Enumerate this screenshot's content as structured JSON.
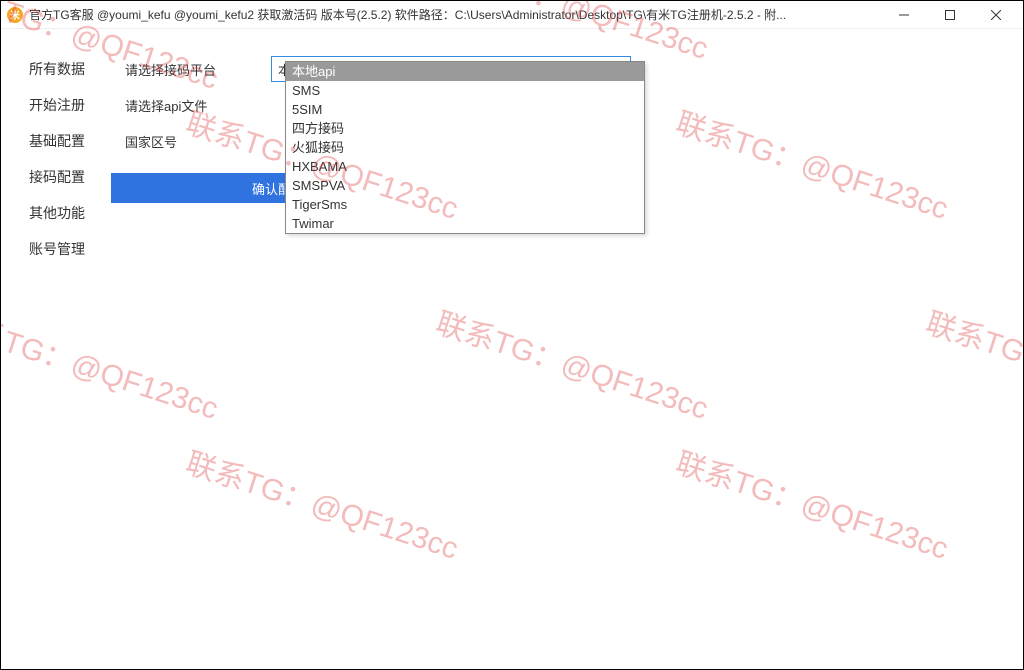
{
  "window": {
    "title": "官方TG客服 @youmi_kefu @youmi_kefu2 获取激活码 版本号(2.5.2) 软件路径：C:\\Users\\Administrator\\Desktop\\TG\\有米TG注册机-2.5.2  - 附...",
    "icon_glyph": "米"
  },
  "sidebar": {
    "items": [
      {
        "label": "所有数据"
      },
      {
        "label": "开始注册"
      },
      {
        "label": "基础配置"
      },
      {
        "label": "接码配置"
      },
      {
        "label": "其他功能"
      },
      {
        "label": "账号管理"
      }
    ]
  },
  "form": {
    "platform_label": "请选择接码平台",
    "apifile_label": "请选择api文件",
    "country_label": "国家区号",
    "confirm_button": "确认配置信息"
  },
  "combo": {
    "selected": "本地api",
    "options": [
      "本地api",
      "SMS",
      "5SIM",
      "四方接码",
      "火狐接码",
      "HXBAMA",
      "SMSPVA",
      "TigerSms",
      "Twimar"
    ]
  },
  "watermark": {
    "text": "联系TG：@QF123cc"
  }
}
